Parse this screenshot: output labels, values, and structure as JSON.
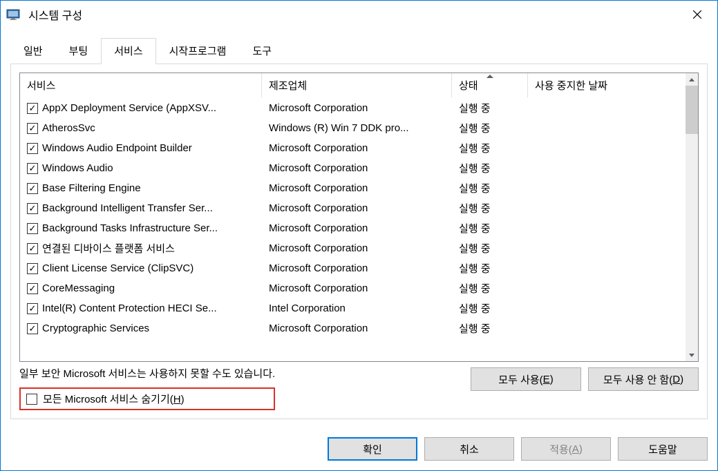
{
  "window": {
    "title": "시스템 구성"
  },
  "tabs": {
    "general": "일반",
    "boot": "부팅",
    "services": "서비스",
    "startup": "시작프로그램",
    "tools": "도구"
  },
  "columns": {
    "service": "서비스",
    "manufacturer": "제조업체",
    "status": "상태",
    "disabled_date": "사용 중지한 날짜"
  },
  "rows": [
    {
      "checked": true,
      "service": "AppX Deployment Service (AppXSV...",
      "manufacturer": "Microsoft Corporation",
      "status": "실행 중"
    },
    {
      "checked": true,
      "service": "AtherosSvc",
      "manufacturer": "Windows (R) Win 7 DDK pro...",
      "status": "실행 중"
    },
    {
      "checked": true,
      "service": "Windows Audio Endpoint Builder",
      "manufacturer": "Microsoft Corporation",
      "status": "실행 중"
    },
    {
      "checked": true,
      "service": "Windows Audio",
      "manufacturer": "Microsoft Corporation",
      "status": "실행 중"
    },
    {
      "checked": true,
      "service": "Base Filtering Engine",
      "manufacturer": "Microsoft Corporation",
      "status": "실행 중"
    },
    {
      "checked": true,
      "service": "Background Intelligent Transfer Ser...",
      "manufacturer": "Microsoft Corporation",
      "status": "실행 중"
    },
    {
      "checked": true,
      "service": "Background Tasks Infrastructure Ser...",
      "manufacturer": "Microsoft Corporation",
      "status": "실행 중"
    },
    {
      "checked": true,
      "service": "연결된 디바이스 플랫폼 서비스",
      "manufacturer": "Microsoft Corporation",
      "status": "실행 중"
    },
    {
      "checked": true,
      "service": "Client License Service (ClipSVC)",
      "manufacturer": "Microsoft Corporation",
      "status": "실행 중"
    },
    {
      "checked": true,
      "service": "CoreMessaging",
      "manufacturer": "Microsoft Corporation",
      "status": "실행 중"
    },
    {
      "checked": true,
      "service": "Intel(R) Content Protection HECI Se...",
      "manufacturer": "Intel Corporation",
      "status": "실행 중"
    },
    {
      "checked": true,
      "service": "Cryptographic Services",
      "manufacturer": "Microsoft Corporation",
      "status": "실행 중"
    }
  ],
  "note": "일부 보안 Microsoft 서비스는 사용하지 못할 수도 있습니다.",
  "hide_ms": {
    "checked": false,
    "label_pre": "모든 Microsoft 서비스 숨기기(",
    "label_key": "H",
    "label_post": ")"
  },
  "buttons": {
    "enable_all_pre": "모두 사용(",
    "enable_all_key": "E",
    "enable_all_post": ")",
    "disable_all_pre": "모두 사용 안 함(",
    "disable_all_key": "D",
    "disable_all_post": ")"
  },
  "dialog_buttons": {
    "ok": "확인",
    "cancel": "취소",
    "apply_pre": "적용(",
    "apply_key": "A",
    "apply_post": ")",
    "help": "도움말"
  }
}
